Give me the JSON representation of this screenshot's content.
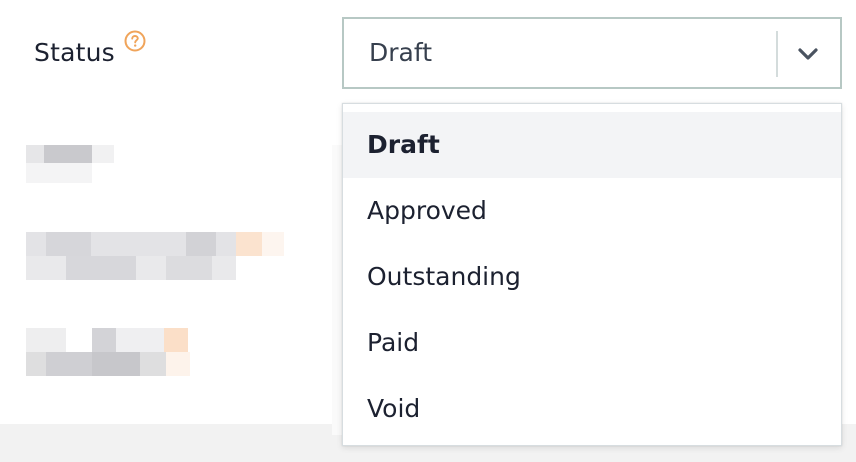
{
  "status_field": {
    "label": "Status",
    "help_icon": "question-circle-icon",
    "selected_value": "Draft",
    "dropdown_icon": "chevron-down-icon"
  },
  "dropdown": {
    "options": [
      {
        "label": "Draft",
        "selected": true
      },
      {
        "label": "Approved",
        "selected": false
      },
      {
        "label": "Outstanding",
        "selected": false
      },
      {
        "label": "Paid",
        "selected": false
      },
      {
        "label": "Void",
        "selected": false
      }
    ]
  },
  "colors": {
    "help_icon": "#f0a45a",
    "select_border": "#b7c8c4",
    "text": "#1c2130",
    "selected_option_bg": "#f3f4f6"
  }
}
